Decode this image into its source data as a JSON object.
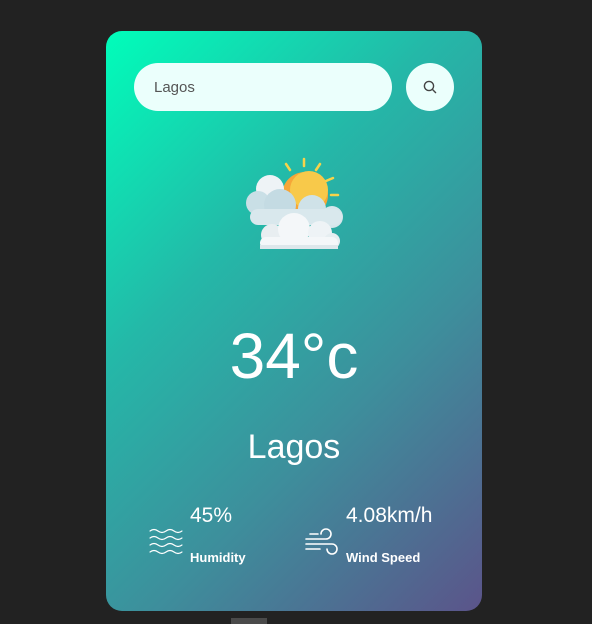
{
  "search": {
    "value": "Lagos",
    "placeholder": "",
    "button_icon": "search-icon"
  },
  "weather": {
    "icon": "partly-cloudy-sun-icon",
    "temperature": "34°c",
    "city": "Lagos"
  },
  "details": {
    "humidity": {
      "icon": "humidity-waves-icon",
      "value": "45%",
      "label": "Humidity"
    },
    "wind": {
      "icon": "wind-icon",
      "value": "4.08km/h",
      "label": "Wind Speed"
    }
  },
  "colors": {
    "background": "#222222",
    "card_gradient_start": "#00feba",
    "card_gradient_end": "#5b548a",
    "search_fill": "#ebfffc",
    "text": "#ffffff"
  }
}
